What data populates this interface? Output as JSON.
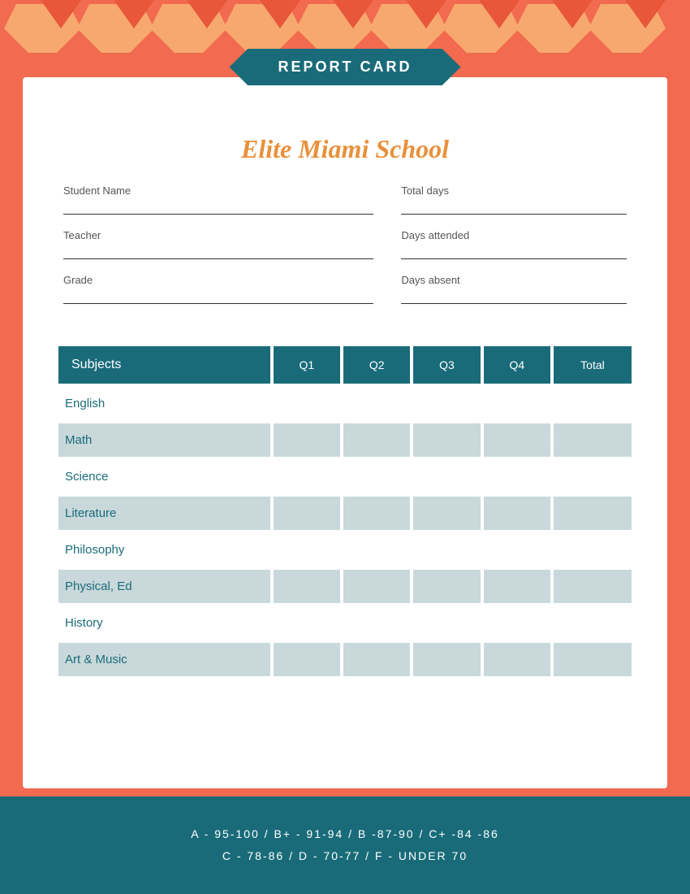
{
  "page": {
    "background_color": "#f26a4f",
    "footer_bg": "#1a6b7a"
  },
  "banner": {
    "title": "REPORT CARD"
  },
  "school": {
    "name": "Elite Miami School"
  },
  "info_fields": {
    "student_name_label": "Student Name",
    "teacher_label": "Teacher",
    "grade_label": "Grade",
    "total_days_label": "Total days",
    "days_attended_label": "Days attended",
    "days_absent_label": "Days absent"
  },
  "table_headers": {
    "subjects": "Subjects",
    "q1": "Q1",
    "q2": "Q2",
    "q3": "Q3",
    "q4": "Q4",
    "total": "Total"
  },
  "subjects": [
    {
      "name": "English",
      "shaded": false
    },
    {
      "name": "Math",
      "shaded": true
    },
    {
      "name": "Science",
      "shaded": false
    },
    {
      "name": "Literature",
      "shaded": true
    },
    {
      "name": "Philosophy",
      "shaded": false
    },
    {
      "name": "Physical, Ed",
      "shaded": true
    },
    {
      "name": "History",
      "shaded": false
    },
    {
      "name": "Art & Music",
      "shaded": true
    }
  ],
  "grading_scale": {
    "line1": "A - 95-100  /  B+ - 91-94  /  B -87-90  /  C+ -84 -86",
    "line2": "C - 78-86  /  D - 70-77  /  F - UNDER 70"
  }
}
